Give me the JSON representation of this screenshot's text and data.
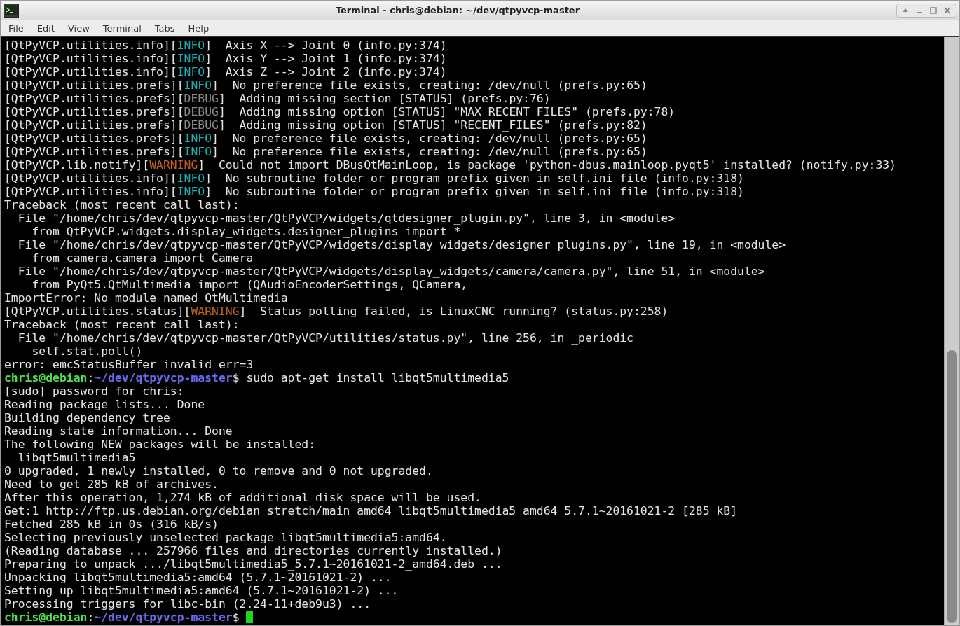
{
  "window": {
    "title": "Terminal - chris@debian: ~/dev/qtpyvcp-master"
  },
  "menu": [
    "File",
    "Edit",
    "View",
    "Terminal",
    "Tabs",
    "Help"
  ],
  "lines": [
    [
      {
        "kind": "plain",
        "text": "[QtPyVCP.utilities.info]["
      },
      {
        "kind": "info",
        "text": "INFO"
      },
      {
        "kind": "plain",
        "text": "]  Axis X --> Joint 0 (info.py:374)"
      }
    ],
    [
      {
        "kind": "plain",
        "text": "[QtPyVCP.utilities.info]["
      },
      {
        "kind": "info",
        "text": "INFO"
      },
      {
        "kind": "plain",
        "text": "]  Axis Y --> Joint 1 (info.py:374)"
      }
    ],
    [
      {
        "kind": "plain",
        "text": "[QtPyVCP.utilities.info]["
      },
      {
        "kind": "info",
        "text": "INFO"
      },
      {
        "kind": "plain",
        "text": "]  Axis Z --> Joint 2 (info.py:374)"
      }
    ],
    [
      {
        "kind": "plain",
        "text": "[QtPyVCP.utilities.prefs]["
      },
      {
        "kind": "info",
        "text": "INFO"
      },
      {
        "kind": "plain",
        "text": "]  No preference file exists, creating: /dev/null (prefs.py:65)"
      }
    ],
    [
      {
        "kind": "plain",
        "text": "[QtPyVCP.utilities.prefs]["
      },
      {
        "kind": "debug",
        "text": "DEBUG"
      },
      {
        "kind": "plain",
        "text": "]  Adding missing section [STATUS] (prefs.py:76)"
      }
    ],
    [
      {
        "kind": "plain",
        "text": "[QtPyVCP.utilities.prefs]["
      },
      {
        "kind": "debug",
        "text": "DEBUG"
      },
      {
        "kind": "plain",
        "text": "]  Adding missing option [STATUS] \"MAX_RECENT_FILES\" (prefs.py:78)"
      }
    ],
    [
      {
        "kind": "plain",
        "text": "[QtPyVCP.utilities.prefs]["
      },
      {
        "kind": "debug",
        "text": "DEBUG"
      },
      {
        "kind": "plain",
        "text": "]  Adding missing option [STATUS] \"RECENT_FILES\" (prefs.py:82)"
      }
    ],
    [
      {
        "kind": "plain",
        "text": "[QtPyVCP.utilities.prefs]["
      },
      {
        "kind": "info",
        "text": "INFO"
      },
      {
        "kind": "plain",
        "text": "]  No preference file exists, creating: /dev/null (prefs.py:65)"
      }
    ],
    [
      {
        "kind": "plain",
        "text": "[QtPyVCP.utilities.prefs]["
      },
      {
        "kind": "info",
        "text": "INFO"
      },
      {
        "kind": "plain",
        "text": "]  No preference file exists, creating: /dev/null (prefs.py:65)"
      }
    ],
    [
      {
        "kind": "plain",
        "text": "[QtPyVCP.lib.notify]["
      },
      {
        "kind": "warning",
        "text": "WARNING"
      },
      {
        "kind": "plain",
        "text": "]  Could not import DBusQtMainLoop, is package 'python-dbus.mainloop.pyqt5' installed? (notify.py:33)"
      }
    ],
    [
      {
        "kind": "plain",
        "text": "[QtPyVCP.utilities.info]["
      },
      {
        "kind": "info",
        "text": "INFO"
      },
      {
        "kind": "plain",
        "text": "]  No subroutine folder or program prefix given in self.ini file (info.py:318)"
      }
    ],
    [
      {
        "kind": "plain",
        "text": "[QtPyVCP.utilities.info]["
      },
      {
        "kind": "info",
        "text": "INFO"
      },
      {
        "kind": "plain",
        "text": "]  No subroutine folder or program prefix given in self.ini file (info.py:318)"
      }
    ],
    [
      {
        "kind": "plain",
        "text": "Traceback (most recent call last):"
      }
    ],
    [
      {
        "kind": "plain",
        "text": "  File \"/home/chris/dev/qtpyvcp-master/QtPyVCP/widgets/qtdesigner_plugin.py\", line 3, in <module>"
      }
    ],
    [
      {
        "kind": "plain",
        "text": "    from QtPyVCP.widgets.display_widgets.designer_plugins import *"
      }
    ],
    [
      {
        "kind": "plain",
        "text": "  File \"/home/chris/dev/qtpyvcp-master/QtPyVCP/widgets/display_widgets/designer_plugins.py\", line 19, in <module>"
      }
    ],
    [
      {
        "kind": "plain",
        "text": "    from camera.camera import Camera"
      }
    ],
    [
      {
        "kind": "plain",
        "text": "  File \"/home/chris/dev/qtpyvcp-master/QtPyVCP/widgets/display_widgets/camera/camera.py\", line 51, in <module>"
      }
    ],
    [
      {
        "kind": "plain",
        "text": "    from PyQt5.QtMultimedia import (QAudioEncoderSettings, QCamera,"
      }
    ],
    [
      {
        "kind": "plain",
        "text": "ImportError: No module named QtMultimedia"
      }
    ],
    [
      {
        "kind": "plain",
        "text": "[QtPyVCP.utilities.status]["
      },
      {
        "kind": "warning",
        "text": "WARNING"
      },
      {
        "kind": "plain",
        "text": "]  Status polling failed, is LinuxCNC running? (status.py:258)"
      }
    ],
    [
      {
        "kind": "plain",
        "text": "Traceback (most recent call last):"
      }
    ],
    [
      {
        "kind": "plain",
        "text": "  File \"/home/chris/dev/qtpyvcp-master/QtPyVCP/utilities/status.py\", line 256, in _periodic"
      }
    ],
    [
      {
        "kind": "plain",
        "text": "    self.stat.poll()"
      }
    ],
    [
      {
        "kind": "plain",
        "text": "error: emcStatusBuffer invalid err=3"
      }
    ],
    [
      {
        "kind": "user",
        "text": "chris@debian"
      },
      {
        "kind": "plain",
        "text": ":"
      },
      {
        "kind": "path",
        "text": "~/dev/qtpyvcp-master"
      },
      {
        "kind": "plain",
        "text": "$ sudo apt-get install libqt5multimedia5"
      }
    ],
    [
      {
        "kind": "plain",
        "text": "[sudo] password for chris: "
      }
    ],
    [
      {
        "kind": "plain",
        "text": "Reading package lists... Done"
      }
    ],
    [
      {
        "kind": "plain",
        "text": "Building dependency tree       "
      }
    ],
    [
      {
        "kind": "plain",
        "text": "Reading state information... Done"
      }
    ],
    [
      {
        "kind": "plain",
        "text": "The following NEW packages will be installed:"
      }
    ],
    [
      {
        "kind": "plain",
        "text": "  libqt5multimedia5"
      }
    ],
    [
      {
        "kind": "plain",
        "text": "0 upgraded, 1 newly installed, 0 to remove and 0 not upgraded."
      }
    ],
    [
      {
        "kind": "plain",
        "text": "Need to get 285 kB of archives."
      }
    ],
    [
      {
        "kind": "plain",
        "text": "After this operation, 1,274 kB of additional disk space will be used."
      }
    ],
    [
      {
        "kind": "plain",
        "text": "Get:1 http://ftp.us.debian.org/debian stretch/main amd64 libqt5multimedia5 amd64 5.7.1~20161021-2 [285 kB]"
      }
    ],
    [
      {
        "kind": "plain",
        "text": "Fetched 285 kB in 0s (316 kB/s)"
      }
    ],
    [
      {
        "kind": "plain",
        "text": "Selecting previously unselected package libqt5multimedia5:amd64."
      }
    ],
    [
      {
        "kind": "plain",
        "text": "(Reading database ... 257966 files and directories currently installed.)"
      }
    ],
    [
      {
        "kind": "plain",
        "text": "Preparing to unpack .../libqt5multimedia5_5.7.1~20161021-2_amd64.deb ..."
      }
    ],
    [
      {
        "kind": "plain",
        "text": "Unpacking libqt5multimedia5:amd64 (5.7.1~20161021-2) ..."
      }
    ],
    [
      {
        "kind": "plain",
        "text": "Setting up libqt5multimedia5:amd64 (5.7.1~20161021-2) ..."
      }
    ],
    [
      {
        "kind": "plain",
        "text": "Processing triggers for libc-bin (2.24-11+deb9u3) ..."
      }
    ],
    [
      {
        "kind": "user",
        "text": "chris@debian"
      },
      {
        "kind": "plain",
        "text": ":"
      },
      {
        "kind": "path",
        "text": "~/dev/qtpyvcp-master"
      },
      {
        "kind": "plain",
        "text": "$ "
      }
    ]
  ],
  "cursor": {
    "visible": true
  }
}
